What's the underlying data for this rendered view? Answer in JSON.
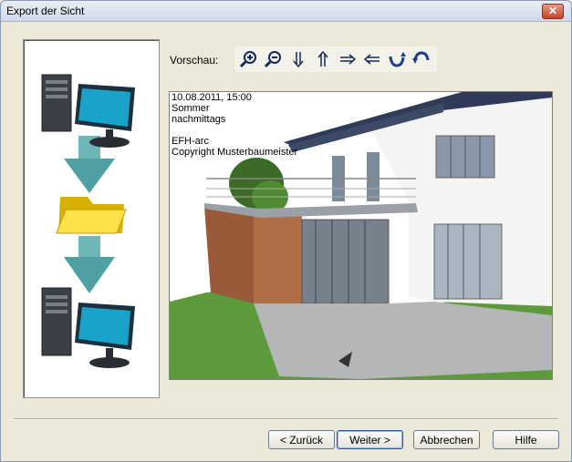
{
  "window": {
    "title": "Export der Sicht",
    "close_glyph": "✕"
  },
  "preview": {
    "label": "Vorschau:",
    "overlay_lines": [
      "10.08.2011, 15:00",
      "Sommer",
      "nachmittags",
      "",
      "EFH-arc",
      "Copyright Musterbaumeister"
    ]
  },
  "toolbar": {
    "icons": [
      "zoom-in-icon",
      "zoom-out-icon",
      "arrow-down-icon",
      "arrow-up-icon",
      "arrow-right-icon",
      "arrow-left-icon",
      "rotate-right-icon",
      "rotate-left-icon"
    ]
  },
  "buttons": {
    "back": "< Zurück",
    "next": "Weiter >",
    "cancel": "Abbrechen",
    "help": "Hilfe"
  }
}
